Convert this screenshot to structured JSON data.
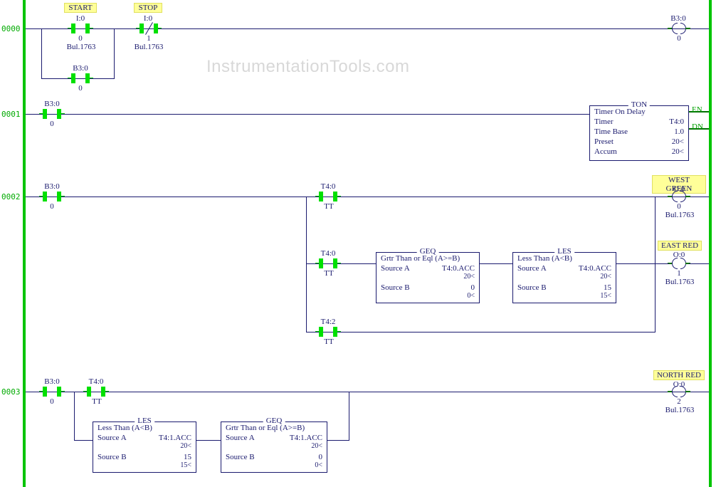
{
  "watermark": "InstrumentationTools.com",
  "rungs": [
    "0000",
    "0001",
    "0002",
    "0003"
  ],
  "r0": {
    "start": {
      "tag": "START",
      "addr": "I:0",
      "bit": "0",
      "bul": "Bul.1763"
    },
    "stop": {
      "tag": "STOP",
      "addr": "I:0",
      "bit": "1",
      "bul": "Bul.1763"
    },
    "latch": {
      "addr": "B3:0",
      "bit": "0"
    },
    "coil": {
      "addr": "B3:0",
      "bit": "0"
    }
  },
  "r1": {
    "enable": {
      "addr": "B3:0",
      "bit": "0"
    },
    "ton": {
      "title": "TON",
      "desc": "Timer On Delay",
      "timer": "T4:0",
      "timebase": "1.0",
      "preset": "20<",
      "accum": "20<",
      "en": "EN",
      "dn": "DN"
    }
  },
  "r2": {
    "enable": {
      "addr": "B3:0",
      "bit": "0"
    },
    "t40tt1": {
      "addr": "T4:0",
      "bit": "TT"
    },
    "t40tt2": {
      "addr": "T4:0",
      "bit": "TT"
    },
    "t42": {
      "addr": "T4:2",
      "bit": "TT"
    },
    "geq": {
      "title": "GEQ",
      "desc": "Grtr Than or Eql (A>=B)",
      "srcA_l": "Source A",
      "srcA_v": "T4:0.ACC",
      "srcA_sub": "20<",
      "srcB_l": "Source B",
      "srcB_v": "0",
      "srcB_sub": "0<"
    },
    "les": {
      "title": "LES",
      "desc": "Less Than (A<B)",
      "srcA_l": "Source A",
      "srcA_v": "T4:0.ACC",
      "srcA_sub": "20<",
      "srcB_l": "Source B",
      "srcB_v": "15",
      "srcB_sub": "15<"
    },
    "west_green": {
      "tag": "WEST GREEN",
      "addr": "O:0",
      "bit": "0",
      "bul": "Bul.1763"
    },
    "east_red": {
      "tag": "EAST RED",
      "addr": "O:0",
      "bit": "1",
      "bul": "Bul.1763"
    }
  },
  "r3": {
    "enable": {
      "addr": "B3:0",
      "bit": "0"
    },
    "t40tt": {
      "addr": "T4:0",
      "bit": "TT"
    },
    "les": {
      "title": "LES",
      "desc": "Less Than (A<B)",
      "srcA_l": "Source A",
      "srcA_v": "T4:1.ACC",
      "srcA_sub": "20<",
      "srcB_l": "Source B",
      "srcB_v": "15",
      "srcB_sub": "15<"
    },
    "geq": {
      "title": "GEQ",
      "desc": "Grtr Than or Eql (A>=B)",
      "srcA_l": "Source A",
      "srcA_v": "T4:1.ACC",
      "srcA_sub": "20<",
      "srcB_l": "Source B",
      "srcB_v": "0",
      "srcB_sub": "0<"
    },
    "north_red": {
      "tag": "NORTH RED",
      "addr": "O:0",
      "bit": "2",
      "bul": "Bul.1763"
    }
  }
}
